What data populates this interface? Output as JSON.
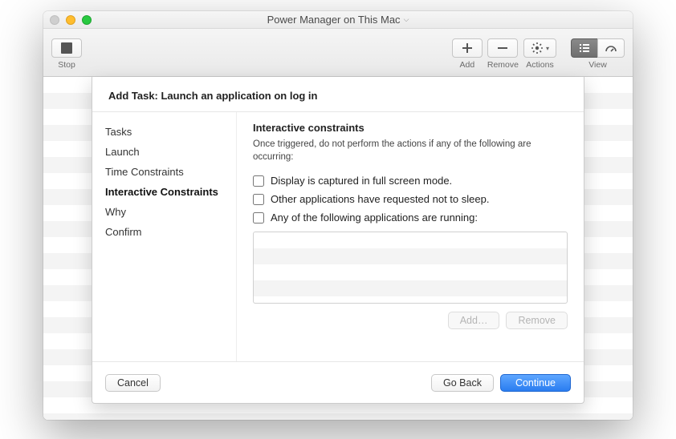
{
  "window": {
    "title": "Power Manager on This Mac"
  },
  "toolbar": {
    "stop_label": "Stop",
    "add_label": "Add",
    "remove_label": "Remove",
    "actions_label": "Actions",
    "view_label": "View"
  },
  "sheet": {
    "header": "Add Task: Launch an application on log in",
    "steps": [
      {
        "label": "Tasks",
        "active": false
      },
      {
        "label": "Launch",
        "active": false
      },
      {
        "label": "Time Constraints",
        "active": false
      },
      {
        "label": "Interactive Constraints",
        "active": true
      },
      {
        "label": "Why",
        "active": false
      },
      {
        "label": "Confirm",
        "active": false
      }
    ],
    "pane": {
      "title": "Interactive constraints",
      "description": "Once triggered, do not perform the actions if any of the following are occurring:",
      "checks": [
        "Display is captured in full screen mode.",
        "Other applications have requested not to sleep.",
        "Any of the following applications are running:"
      ],
      "list_add_label": "Add…",
      "list_remove_label": "Remove"
    },
    "footer": {
      "cancel_label": "Cancel",
      "back_label": "Go Back",
      "continue_label": "Continue"
    }
  }
}
